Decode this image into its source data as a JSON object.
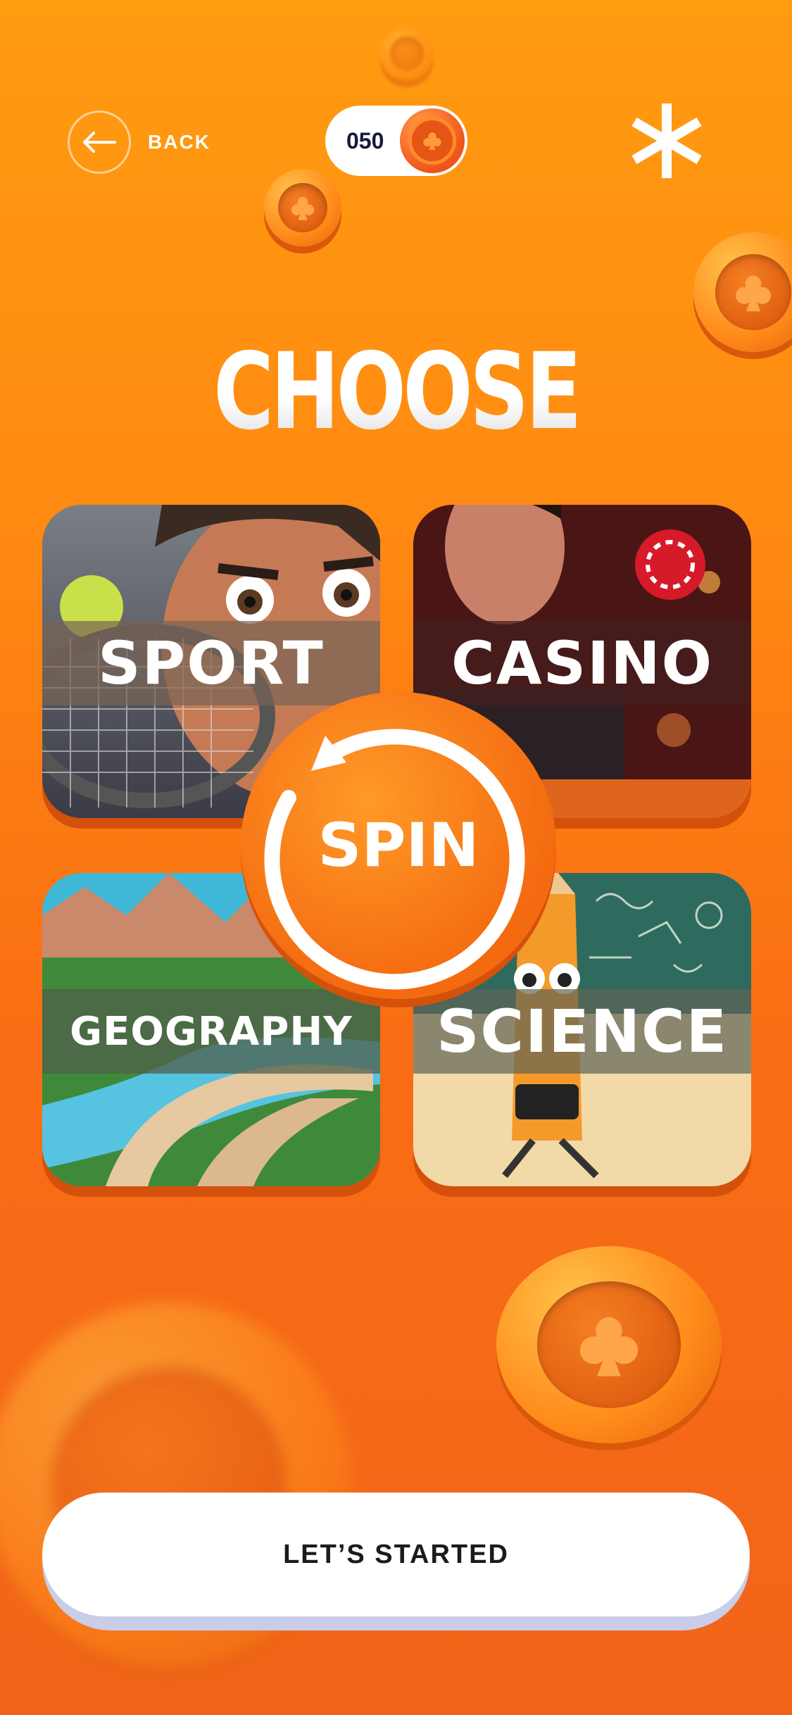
{
  "header": {
    "back_label": "BACK",
    "balance": "050",
    "back_icon": "arrow-left-icon",
    "menu_icon": "asterisk-icon",
    "coin_icon": "coin-icon"
  },
  "title": "CHOOSE",
  "categories": [
    {
      "label": "SPORT",
      "image": "tennis-player-cartoon"
    },
    {
      "label": "CASINO",
      "image": "casino-dealer-cartoon"
    },
    {
      "label": "GEOGRAPHY",
      "image": "canyon-road-landscape"
    },
    {
      "label": "SCIENCE",
      "image": "pencil-character-classroom"
    }
  ],
  "spin_label": "SPIN",
  "cta_label": "LET’S STARTED",
  "colors": {
    "background_top": "#FF9C10",
    "background_bottom": "#F2641A",
    "accent": "#F46A10",
    "card_shadow": "#D4510B",
    "text_dark": "#141B3A"
  }
}
